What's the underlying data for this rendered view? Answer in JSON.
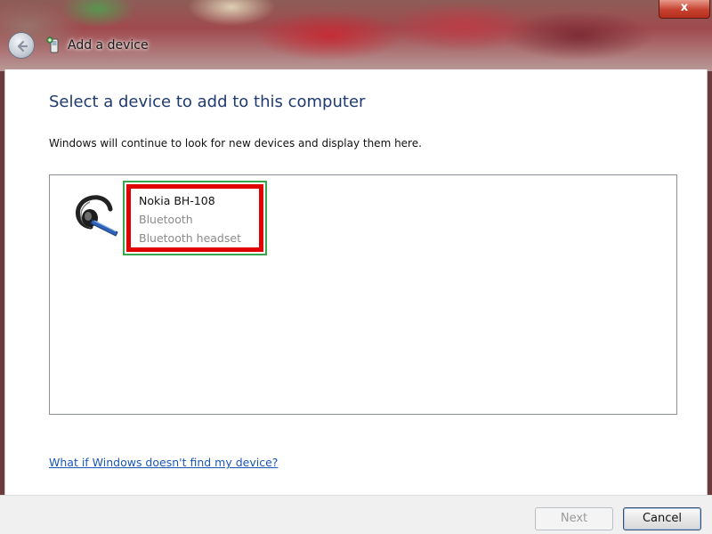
{
  "window": {
    "title": "Add a device",
    "close_label": "x"
  },
  "main": {
    "heading": "Select a device to add to this computer",
    "instruction": "Windows will continue to look for new devices and display them here.",
    "devices": [
      {
        "name": "Nokia BH-108",
        "type": "Bluetooth",
        "category": "Bluetooth headset",
        "icon": "bluetooth-headset-icon",
        "selected": true
      }
    ],
    "help_link": "What if Windows doesn't find my device?"
  },
  "footer": {
    "next_label": "Next",
    "cancel_label": "Cancel",
    "next_enabled": false
  },
  "colors": {
    "heading": "#1e3a6e",
    "link": "#1a56b8",
    "highlight_red": "#e00000",
    "selection_green": "#3aa64b"
  }
}
